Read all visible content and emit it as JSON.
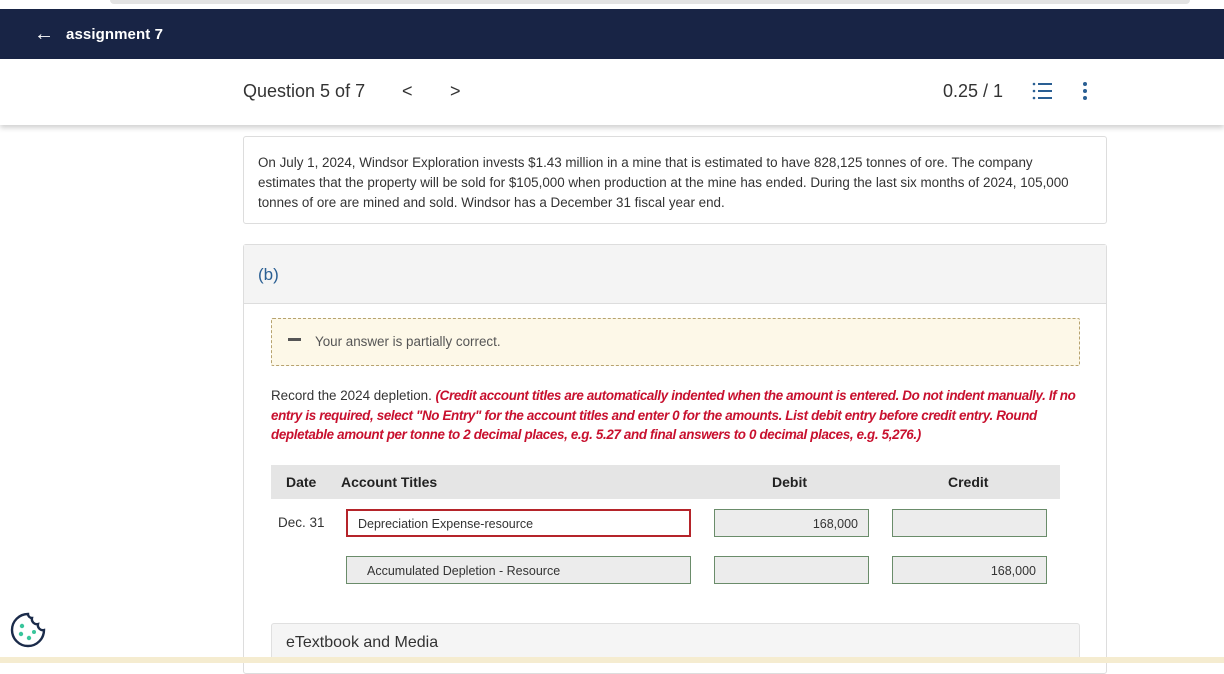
{
  "header": {
    "title": "assignment 7",
    "back_icon": "arrow-left-icon"
  },
  "question_bar": {
    "label": "Question 5 of 7",
    "prev": "<",
    "next": ">",
    "score": "0.25 / 1",
    "list_icon": "list-icon",
    "more_icon": "more-vertical-icon"
  },
  "problem": {
    "text": "On July 1, 2024, Windsor Exploration invests $1.43 million in a mine that is estimated to have 828,125 tonnes of ore. The company estimates that the property will be sold for $105,000 when production at the mine has ended. During the last six months of 2024, 105,000 tonnes of ore are mined and sold. Windsor has a December 31 fiscal year end."
  },
  "part": {
    "label": "(b)",
    "feedback": "Your answer is partially correct.",
    "instruction_plain": "Record the 2024 depletion.",
    "instruction_red": "(Credit account titles are automatically indented when the amount is entered. Do not indent manually. If no entry is required, select \"No Entry\" for the account titles and enter 0 for the amounts. List debit entry before credit entry. Round depletable amount per tonne to 2 decimal places, e.g. 5.27 and final answers to 0 decimal places, e.g. 5,276.)"
  },
  "journal": {
    "headers": {
      "date": "Date",
      "account": "Account Titles",
      "debit": "Debit",
      "credit": "Credit"
    },
    "rows": [
      {
        "date": "Dec. 31",
        "account": "Depreciation Expense-resource",
        "debit": "168,000",
        "credit": ""
      },
      {
        "date": "",
        "account": "Accumulated Depletion - Resource",
        "debit": "",
        "credit": "168,000"
      }
    ]
  },
  "etextbook": {
    "label": "eTextbook and Media"
  },
  "cookie_icon": "cookie-icon",
  "colors": {
    "header_bg": "#182445",
    "link_blue": "#2a5f93",
    "error_red": "#c8102e",
    "feedback_bg": "#fdf8e8"
  }
}
